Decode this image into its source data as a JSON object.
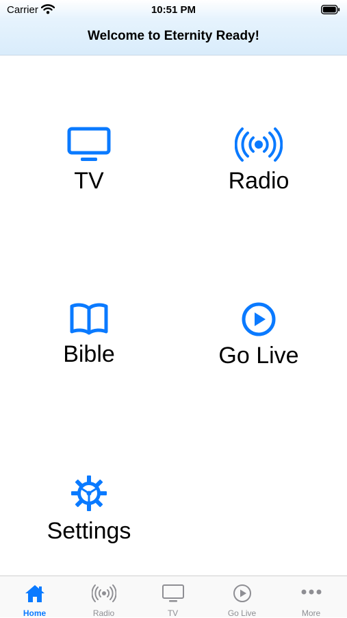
{
  "status_bar": {
    "carrier": "Carrier",
    "time": "10:51 PM"
  },
  "header": {
    "title": "Welcome to Eternity Ready!"
  },
  "tiles": [
    {
      "label": "TV",
      "icon": "tv-icon"
    },
    {
      "label": "Radio",
      "icon": "radio-broadcast-icon"
    },
    {
      "label": "Bible",
      "icon": "book-icon"
    },
    {
      "label": "Go Live",
      "icon": "play-circle-icon"
    },
    {
      "label": "Settings",
      "icon": "gear-icon"
    }
  ],
  "tabbar": {
    "active": "Home",
    "items": [
      {
        "label": "Home",
        "icon": "house-icon"
      },
      {
        "label": "Radio",
        "icon": "radio-broadcast-icon"
      },
      {
        "label": "TV",
        "icon": "tv-icon"
      },
      {
        "label": "Go Live",
        "icon": "play-circle-icon"
      },
      {
        "label": "More",
        "icon": "ellipsis-icon"
      }
    ]
  },
  "colors": {
    "accent": "#0a7aff",
    "inactive": "#8e8e93",
    "header_bg": "#d9ecfb"
  }
}
